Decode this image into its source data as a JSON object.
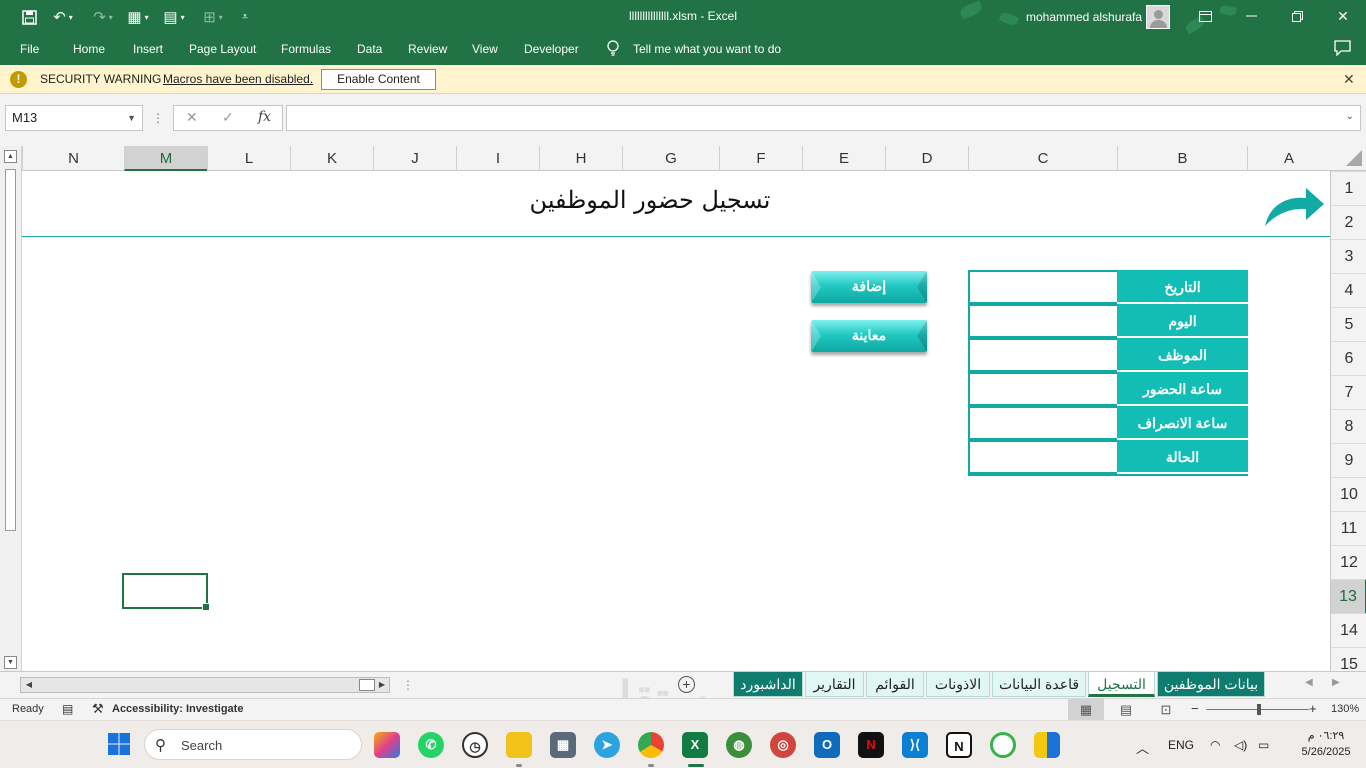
{
  "window": {
    "document_title": "lllllllllllllll.xlsm  -  Excel",
    "user_name": "mohammed alshurafa"
  },
  "menu": {
    "items": [
      "File",
      "Home",
      "Insert",
      "Page Layout",
      "Formulas",
      "Data",
      "Review",
      "View",
      "Developer"
    ],
    "tell_me": "Tell me what you want to do"
  },
  "security": {
    "title": "SECURITY WARNING",
    "message": "Macros have been disabled.",
    "enable_button": "Enable Content"
  },
  "formula_bar": {
    "name_box": "M13",
    "cancel_glyph": "✕",
    "enter_glyph": "✓",
    "fx_glyph": "fx",
    "formula_value": ""
  },
  "grid": {
    "columns": [
      "N",
      "M",
      "L",
      "K",
      "J",
      "I",
      "H",
      "G",
      "F",
      "E",
      "D",
      "C",
      "B",
      "A"
    ],
    "selected_column": "M",
    "rows": [
      "1",
      "2",
      "3",
      "4",
      "5",
      "6",
      "7",
      "8",
      "9",
      "10",
      "11",
      "12",
      "13",
      "14",
      "15"
    ],
    "selected_row": "13"
  },
  "sheet": {
    "title": "تسجيل حضور الموظفين",
    "fields": [
      "التاريخ",
      "اليوم",
      "الموظف",
      "ساعة الحضور",
      "ساعة الانصراف",
      "الحالة"
    ],
    "buttons": {
      "add": "إضافة",
      "preview": "معاينة"
    }
  },
  "tabs": [
    {
      "label": "بيانات الموظفين",
      "style": "dark"
    },
    {
      "label": "التسجيل",
      "style": "active"
    },
    {
      "label": "قاعدة البيانات",
      "style": "light"
    },
    {
      "label": "الاذونات",
      "style": "light"
    },
    {
      "label": "القوائم",
      "style": "light"
    },
    {
      "label": "التقارير",
      "style": "light"
    },
    {
      "label": "الداشبورد",
      "style": "dark"
    }
  ],
  "status": {
    "ready": "Ready",
    "accessibility": "Accessibility: Investigate",
    "zoom": "130%"
  },
  "taskbar": {
    "search_label": "Search",
    "language": "ENG",
    "time": "٠٦:٢٩ م",
    "date": "5/26/2025"
  },
  "watermark": "مستقل",
  "colors": {
    "excel_green": "#217346",
    "teal_label": "#12bdb6",
    "teal_border": "#12a9a3"
  }
}
